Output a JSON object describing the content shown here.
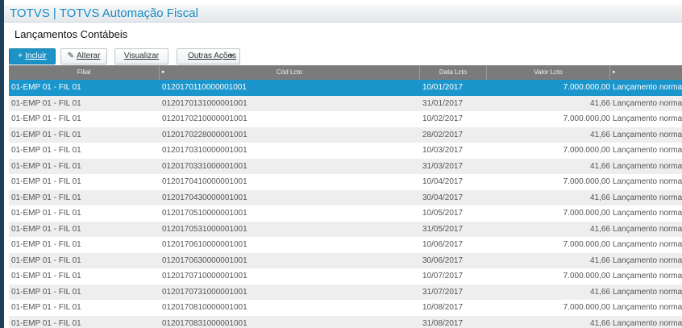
{
  "app": {
    "title": "TOTVS | TOTVS Automação Fiscal"
  },
  "page": {
    "title": "Lançamentos Contábeis"
  },
  "toolbar": {
    "incluir_icon": "+",
    "incluir_label": "Incluir",
    "alterar_icon": "✎",
    "alterar_label": "Alterar",
    "visualizar_label": "Visualizar",
    "outras_label": "Outras Ações",
    "outras_caret": "▼"
  },
  "grid": {
    "headers": {
      "filial": "Filial",
      "sort_arrow": "▸",
      "cod": "Cód Lcto",
      "data": "Data Lcto",
      "valor": "Valor Lcto",
      "extra_arrow": "▸"
    },
    "rows": [
      {
        "filial": "01-EMP 01 - FIL 01",
        "cod": "0120170110000001001",
        "data": "10/01/2017",
        "valor": "7.000.000,00",
        "tipo": "Lançamento normal"
      },
      {
        "filial": "01-EMP 01 - FIL 01",
        "cod": "0120170131000001001",
        "data": "31/01/2017",
        "valor": "41,66",
        "tipo": "Lançamento normal"
      },
      {
        "filial": "01-EMP 01 - FIL 01",
        "cod": "0120170210000001001",
        "data": "10/02/2017",
        "valor": "7.000.000,00",
        "tipo": "Lançamento normal"
      },
      {
        "filial": "01-EMP 01 - FIL 01",
        "cod": "0120170228000001001",
        "data": "28/02/2017",
        "valor": "41,66",
        "tipo": "Lançamento normal"
      },
      {
        "filial": "01-EMP 01 - FIL 01",
        "cod": "0120170310000001001",
        "data": "10/03/2017",
        "valor": "7.000.000,00",
        "tipo": "Lançamento normal"
      },
      {
        "filial": "01-EMP 01 - FIL 01",
        "cod": "0120170331000001001",
        "data": "31/03/2017",
        "valor": "41,66",
        "tipo": "Lançamento normal"
      },
      {
        "filial": "01-EMP 01 - FIL 01",
        "cod": "0120170410000001001",
        "data": "10/04/2017",
        "valor": "7.000.000,00",
        "tipo": "Lançamento normal"
      },
      {
        "filial": "01-EMP 01 - FIL 01",
        "cod": "0120170430000001001",
        "data": "30/04/2017",
        "valor": "41,66",
        "tipo": "Lançamento normal"
      },
      {
        "filial": "01-EMP 01 - FIL 01",
        "cod": "0120170510000001001",
        "data": "10/05/2017",
        "valor": "7.000.000,00",
        "tipo": "Lançamento normal"
      },
      {
        "filial": "01-EMP 01 - FIL 01",
        "cod": "0120170531000001001",
        "data": "31/05/2017",
        "valor": "41,66",
        "tipo": "Lançamento normal"
      },
      {
        "filial": "01-EMP 01 - FIL 01",
        "cod": "0120170610000001001",
        "data": "10/06/2017",
        "valor": "7.000.000,00",
        "tipo": "Lançamento normal"
      },
      {
        "filial": "01-EMP 01 - FIL 01",
        "cod": "0120170630000001001",
        "data": "30/06/2017",
        "valor": "41,66",
        "tipo": "Lançamento normal"
      },
      {
        "filial": "01-EMP 01 - FIL 01",
        "cod": "0120170710000001001",
        "data": "10/07/2017",
        "valor": "7.000.000,00",
        "tipo": "Lançamento normal"
      },
      {
        "filial": "01-EMP 01 - FIL 01",
        "cod": "0120170731000001001",
        "data": "31/07/2017",
        "valor": "41,66",
        "tipo": "Lançamento normal"
      },
      {
        "filial": "01-EMP 01 - FIL 01",
        "cod": "0120170810000001001",
        "data": "10/08/2017",
        "valor": "7.000.000,00",
        "tipo": "Lançamento normal"
      },
      {
        "filial": "01-EMP 01 - FIL 01",
        "cod": "0120170831000001001",
        "data": "31/08/2017",
        "valor": "41,66",
        "tipo": "Lançamento normal"
      }
    ],
    "selected_row": 0
  },
  "colors": {
    "accent": "#1b93c7",
    "selected_row": "#1b96cc",
    "header_bg": "#7b7b7b",
    "left_bar": "#1f3f5a"
  }
}
